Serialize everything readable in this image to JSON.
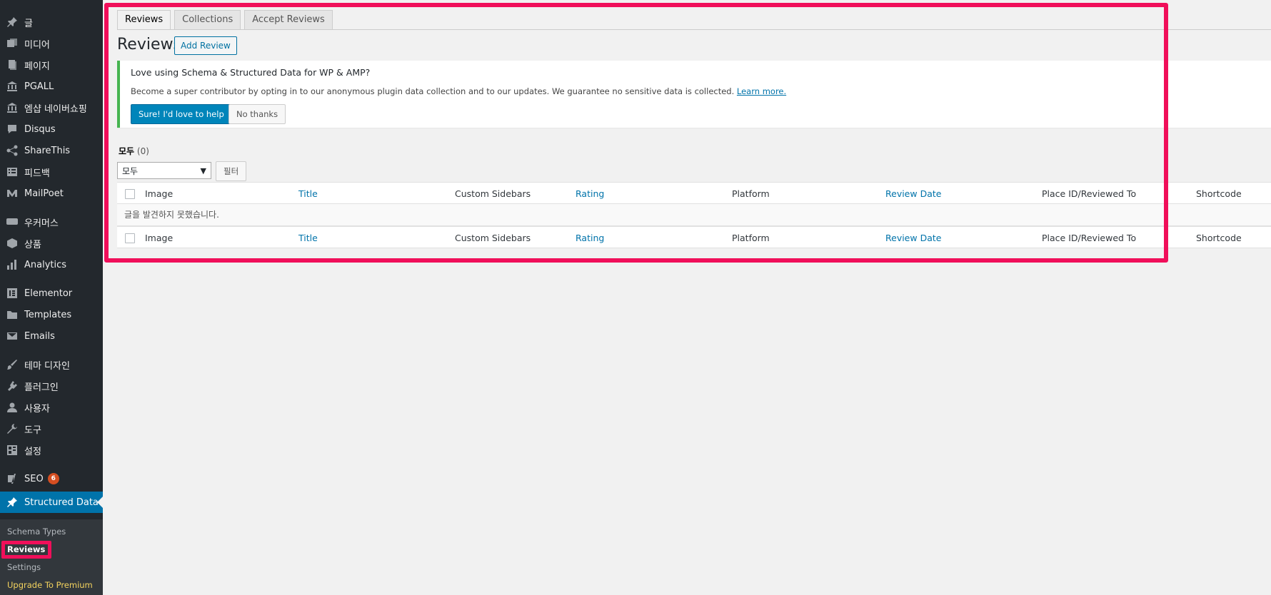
{
  "sidebar": {
    "items": [
      {
        "label": "글",
        "icon": "pin-icon"
      },
      {
        "label": "미디어",
        "icon": "media-icon"
      },
      {
        "label": "페이지",
        "icon": "pages-icon"
      },
      {
        "label": "PGALL",
        "icon": "bank-icon"
      },
      {
        "label": "엠샵 네이버쇼핑",
        "icon": "bank-icon"
      },
      {
        "label": "Disqus",
        "icon": "comment-icon"
      },
      {
        "label": "ShareThis",
        "icon": "share-icon"
      },
      {
        "label": "피드백",
        "icon": "feedback-icon"
      },
      {
        "label": "MailPoet",
        "icon": "mailpoet-icon"
      },
      {
        "label": "우커머스",
        "icon": "woo-icon"
      },
      {
        "label": "상품",
        "icon": "box-icon"
      },
      {
        "label": "Analytics",
        "icon": "chart-icon"
      },
      {
        "label": "Elementor",
        "icon": "elementor-icon"
      },
      {
        "label": "Templates",
        "icon": "folder-icon"
      },
      {
        "label": "Emails",
        "icon": "email-icon"
      },
      {
        "label": "테마 디자인",
        "icon": "brush-icon"
      },
      {
        "label": "플러그인",
        "icon": "plugin-icon"
      },
      {
        "label": "사용자",
        "icon": "user-icon"
      },
      {
        "label": "도구",
        "icon": "wrench-icon"
      },
      {
        "label": "설정",
        "icon": "settings-icon"
      },
      {
        "label": "SEO",
        "icon": "yoast-icon",
        "badge": "6"
      },
      {
        "label": "Structured Data",
        "icon": "pin-icon",
        "active": true
      }
    ],
    "submenu": [
      {
        "label": "Schema Types"
      },
      {
        "label": "Reviews",
        "current": true
      },
      {
        "label": "Settings"
      },
      {
        "label": "Upgrade To Premium"
      }
    ]
  },
  "tabs": [
    {
      "label": "Reviews",
      "active": true
    },
    {
      "label": "Collections"
    },
    {
      "label": "Accept Reviews"
    }
  ],
  "page": {
    "title": "Reviews",
    "add_button": "Add Review"
  },
  "notice": {
    "title": "Love using Schema & Structured Data for WP & AMP?",
    "text": "Become a super contributor by opting in to our anonymous plugin data collection and to our updates. We guarantee no sensitive data is collected.",
    "link": "Learn more.",
    "accept_button": "Sure! I'd love to help",
    "decline_button": "No thanks"
  },
  "filters": {
    "view_label": "모두",
    "view_count": "(0)",
    "select_value": "모두",
    "filter_button": "필터"
  },
  "table": {
    "columns": [
      "Image",
      "Title",
      "Custom Sidebars",
      "Rating",
      "Platform",
      "Review Date",
      "Place ID/Reviewed To",
      "Shortcode"
    ],
    "empty_message": "글을 발견하지 못했습니다."
  },
  "colors": {
    "sidebar_bg": "#23282d",
    "active": "#0073aa",
    "highlight": "#f00f5a",
    "notice_border": "#46b450"
  }
}
